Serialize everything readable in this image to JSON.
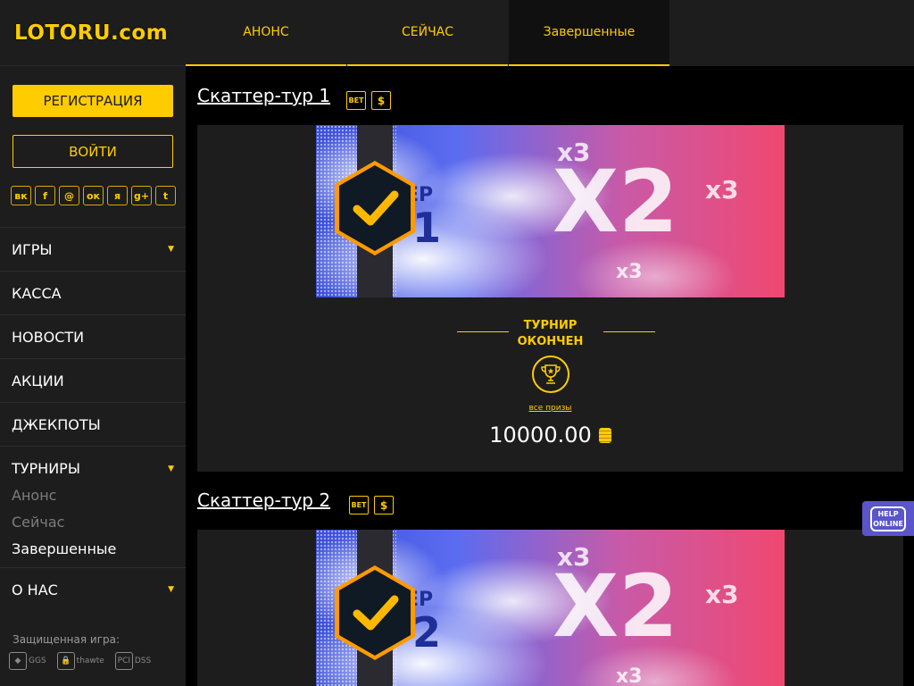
{
  "brand": {
    "logo": "LOTORU.com",
    "accent": "#ffcc00"
  },
  "auth": {
    "register": "РЕГИСТРАЦИЯ",
    "login": "ВОЙТИ"
  },
  "socials": [
    {
      "name": "vk-icon",
      "glyph": "вк"
    },
    {
      "name": "facebook-icon",
      "glyph": "f"
    },
    {
      "name": "mail-icon",
      "glyph": "@"
    },
    {
      "name": "odnoklassniki-icon",
      "glyph": "ок"
    },
    {
      "name": "yandex-icon",
      "glyph": "я"
    },
    {
      "name": "google-plus-icon",
      "glyph": "g+"
    },
    {
      "name": "twitter-icon",
      "glyph": "t"
    }
  ],
  "menu": {
    "games": "ИГРЫ",
    "cashier": "КАССА",
    "news": "НОВОСТИ",
    "promos": "АКЦИИ",
    "jackpots": "ДЖЕКПОТЫ",
    "tournaments": "ТУРНИРЫ",
    "sub": {
      "announce": "Анонс",
      "now": "Сейчас",
      "finished": "Завершенные"
    },
    "about": "О НАС"
  },
  "secure": {
    "label": "Защищенная игра:",
    "logos": [
      "GGS",
      "thawte",
      "DSS"
    ]
  },
  "tabs": [
    {
      "label": "АНОНС"
    },
    {
      "label": "СЕЙЧАС"
    },
    {
      "label": "Завершенные"
    }
  ],
  "tournaments": [
    {
      "title": "Скаттер-тур 1",
      "badges": [
        "BET",
        "$"
      ],
      "banner": {
        "word": "ЕР",
        "number": "1",
        "big": "X2",
        "x3": "x3"
      },
      "status": [
        "ТУРНИР",
        "ОКОНЧЕН"
      ],
      "prizes_link": "все призы",
      "amount": "10000.00"
    },
    {
      "title": "Скаттер-тур 2",
      "badges": [
        "BET",
        "$"
      ],
      "banner": {
        "word": "ЕР",
        "number": "2",
        "big": "X2",
        "x3": "x3"
      }
    }
  ],
  "help": {
    "line1": "HELP",
    "line2": "ONLINE"
  }
}
